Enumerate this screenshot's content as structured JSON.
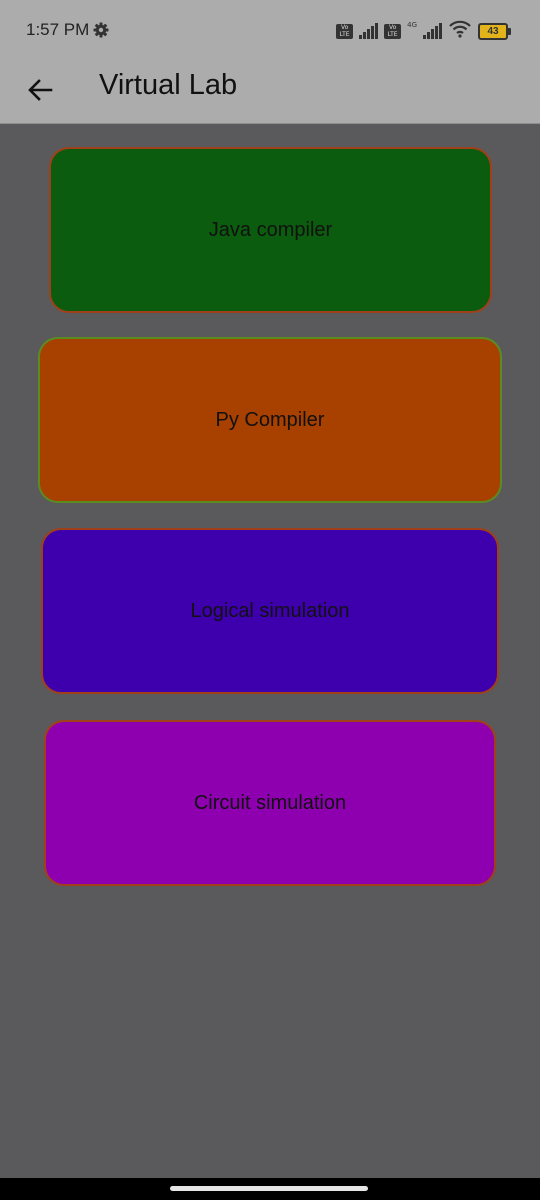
{
  "status_bar": {
    "time": "1:57 PM",
    "volte_label": "Vo LTE",
    "network_label": "4G",
    "battery_level": "43"
  },
  "app_bar": {
    "title": "Virtual Lab",
    "back_icon": "arrow-left-icon"
  },
  "cards": [
    {
      "label": "Java compiler",
      "color": "#0b5c0e"
    },
    {
      "label": "Py Compiler",
      "color": "#a84000"
    },
    {
      "label": "Logical simulation",
      "color": "#3e00ad"
    },
    {
      "label": "Circuit simulation",
      "color": "#8e00af"
    }
  ],
  "colors": {
    "background": "#5a595b",
    "app_bar": "#adacad"
  }
}
